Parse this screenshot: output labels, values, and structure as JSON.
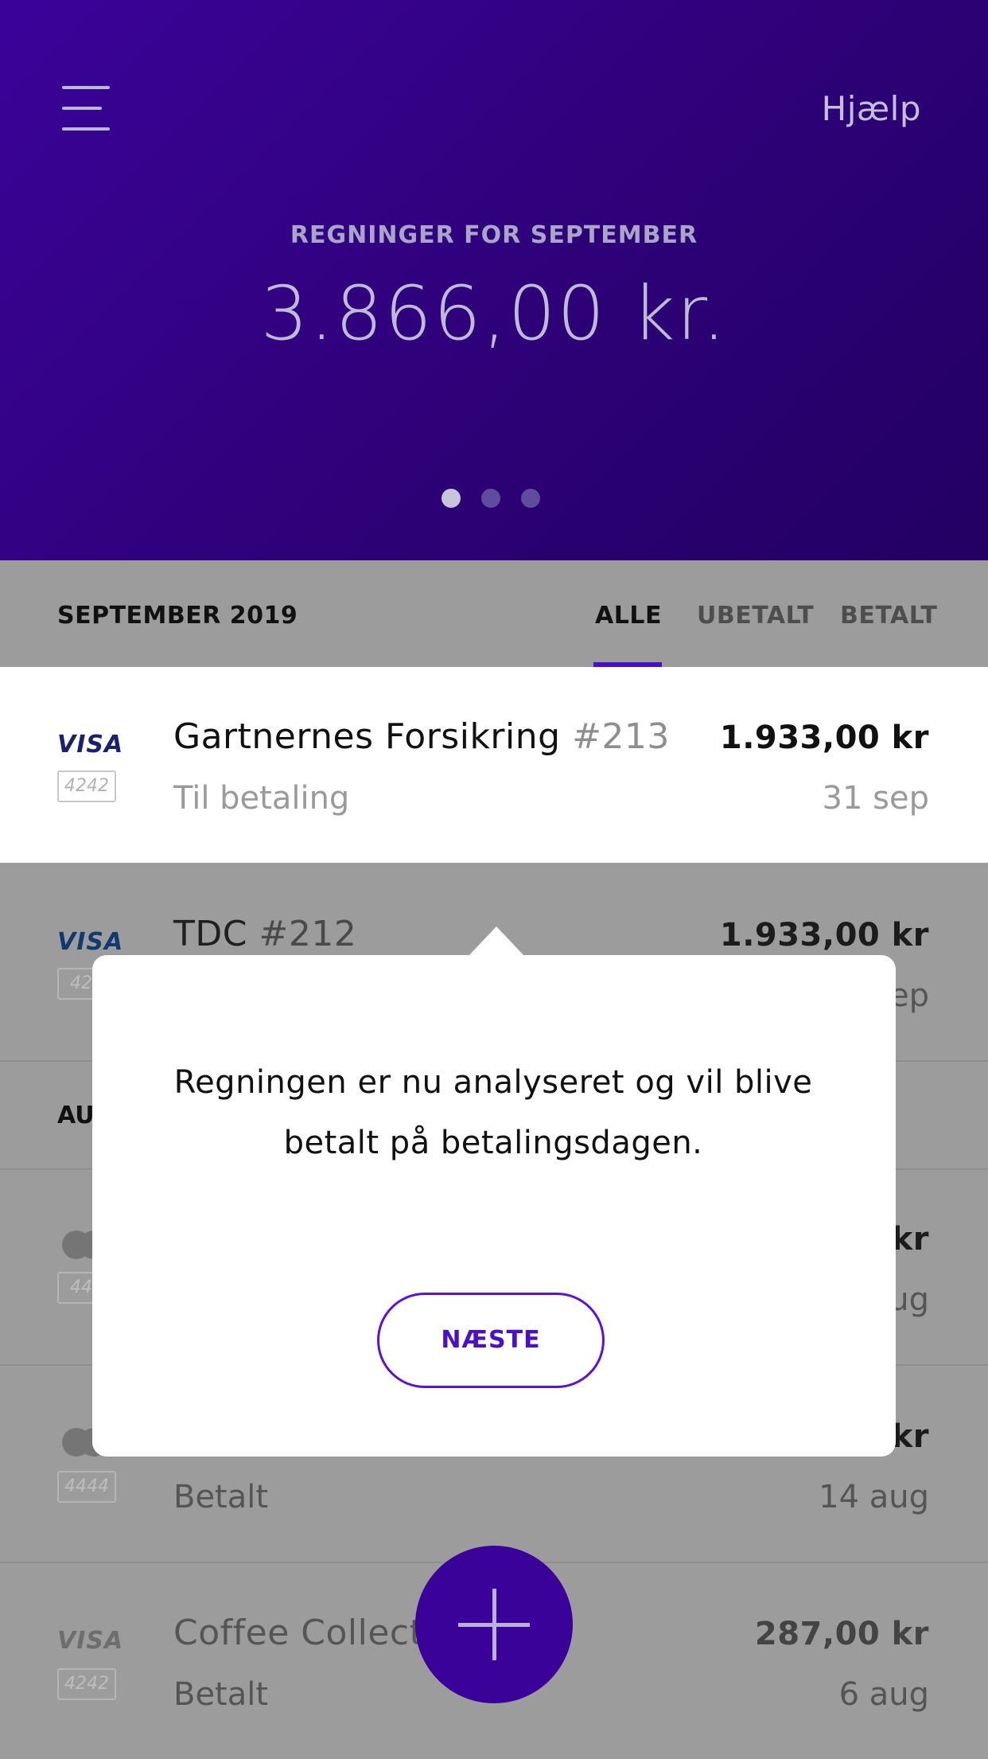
{
  "header": {
    "menu_icon": "hamburger-menu-icon",
    "help_label": "Hjælp",
    "subtitle": "REGNINGER FOR SEPTEMBER",
    "total_amount": "3.866,00 kr.",
    "carousel": {
      "pages": 3,
      "active_index": 0
    },
    "background_color": "#33018a"
  },
  "filter_bar": {
    "month_label": "SEPTEMBER 2019",
    "tabs": [
      {
        "label": "ALLE",
        "active": true
      },
      {
        "label": "UBETALT",
        "active": false
      },
      {
        "label": "BETALT",
        "active": false
      }
    ],
    "accent_color": "#4a10c8"
  },
  "bills": [
    {
      "card_brand": "VISA",
      "card_last4": "4242",
      "payee": "Gartnernes Forsikring",
      "bill_number": "#213",
      "status": "Til betaling",
      "amount": "1.933,00 kr",
      "date": "31 sep"
    },
    {
      "card_brand": "VISA",
      "card_last4": "424",
      "payee": "TDC",
      "bill_number": "#212",
      "status": "",
      "amount": "1.933,00 kr",
      "date": "ep"
    },
    {
      "section_label": "AU"
    },
    {
      "card_brand": "mastercard",
      "card_last4": "444",
      "payee": "",
      "amount": "kr",
      "date": "ug"
    },
    {
      "card_brand": "mastercard",
      "card_last4": "4444",
      "payee": "",
      "status": "Betalt",
      "amount": "kr",
      "date": "14 aug"
    },
    {
      "card_brand": "VISA",
      "card_last4": "4242",
      "payee": "Coffee Collecti",
      "status": "Betalt",
      "amount": "287,00 kr",
      "date": "6 aug"
    }
  ],
  "dialog": {
    "message": "Regningen er nu analyseret og vil blive betalt på betalingsdagen.",
    "button_label": "NÆSTE"
  },
  "fab": {
    "icon": "plus-icon",
    "color": "#3b0299"
  }
}
